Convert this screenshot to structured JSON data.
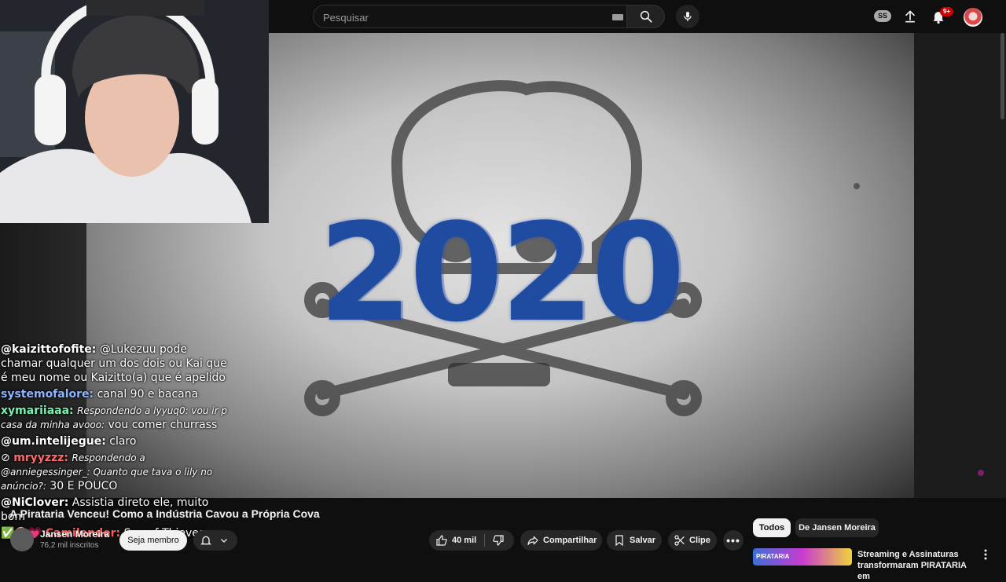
{
  "header": {
    "search_placeholder": "Pesquisar",
    "account_badge": "SS",
    "notification_count": "9+"
  },
  "video": {
    "overlay_year": "2020",
    "overlay_color": "#1f4ca0"
  },
  "chat": {
    "messages": [
      {
        "user": "@kaizittofofite:",
        "user_color": "#ffffff",
        "text": "@Lukezuu pode chamar qualquer um dos dois ou Kai que é meu nome ou Kaizitto(a) que é apelido"
      },
      {
        "user": "systemofalore:",
        "user_color": "#8fb4ff",
        "text": "canal 90 e bacana"
      },
      {
        "user": "xymariiaaa:",
        "user_color": "#7cf0b0",
        "reply": "Respondendo a lyyuq0: vou ir p casa da minha avooo:",
        "text": "vou comer churrass"
      },
      {
        "user": "@um.intelijegue:",
        "user_color": "#ffffff",
        "text": "claro"
      },
      {
        "user": "mryyzzz:",
        "user_color": "#ff6b6b",
        "reply": "Respondendo a @anniegessinger_: Quanto que tava o lily no anúncio?:",
        "text": "30 E POUCO"
      },
      {
        "user": "@NiClover:",
        "user_color": "#ffffff",
        "text": "Assistia direto ele, muito bom"
      },
      {
        "user": "Camilender:",
        "user_color": "#ff5a5a",
        "text": "Sea of Thieves"
      }
    ]
  },
  "video_info": {
    "title": "A Pirataria Venceu! Como a Indústria Cavou a Própria Cova",
    "channel_name": "Jansen Moreira",
    "subscribers": "76,2 mil inscritos",
    "member_label": "Seja membro",
    "like_count": "40 mil",
    "share_label": "Compartilhar",
    "save_label": "Salvar",
    "clip_label": "Clipe"
  },
  "recommendations": {
    "chips": [
      "Todos",
      "De Jansen Moreira"
    ],
    "first_item": {
      "title": "Streaming e Assinaturas transformaram PIRATARIA em",
      "thumb_text": "PIRATARIA"
    }
  }
}
